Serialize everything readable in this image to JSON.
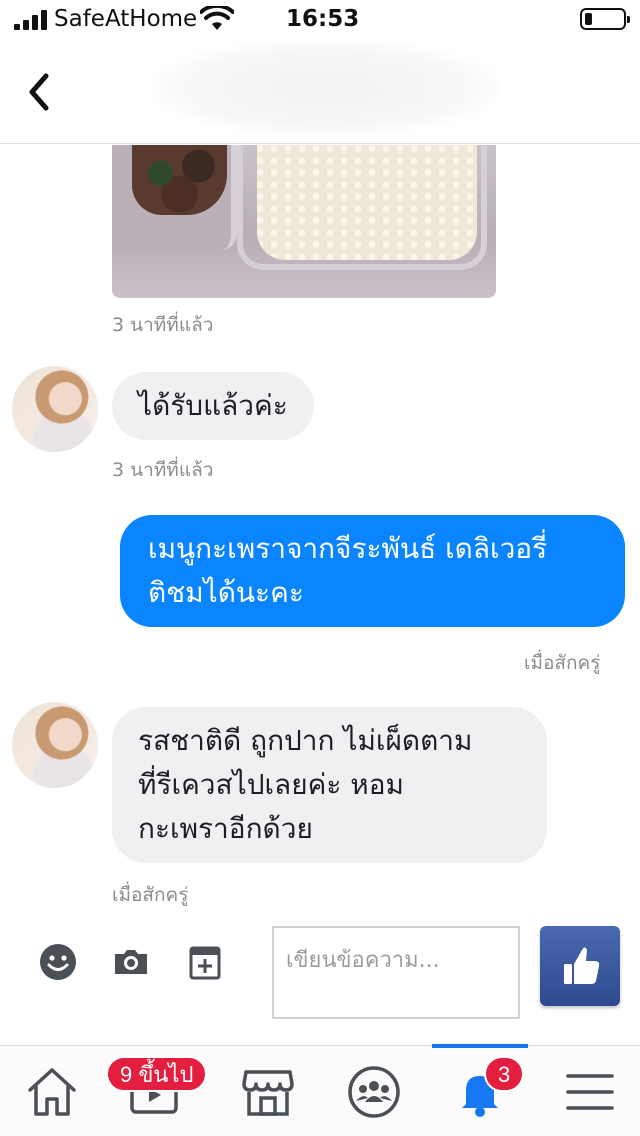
{
  "status_bar": {
    "carrier": "SafeAtHome",
    "time": "16:53"
  },
  "header": {
    "back_icon": "chevron-left-icon"
  },
  "messages": [
    {
      "type": "image",
      "direction": "incoming",
      "timestamp": "3 นาทีที่แล้ว"
    },
    {
      "type": "text",
      "direction": "incoming",
      "lines": [
        "ได้รับแล้วค่ะ"
      ],
      "timestamp": "3 นาทีที่แล้ว"
    },
    {
      "type": "text",
      "direction": "outgoing",
      "lines": [
        "เมนูกะเพราจากจีระพันธ์ เดลิเวอรี่",
        "ติชมได้นะคะ"
      ],
      "timestamp": "เมื่อสักครู่"
    },
    {
      "type": "text",
      "direction": "incoming",
      "lines": [
        "รสชาติดี ถูกปาก ไม่เผ็ดตาม",
        "ที่รีเควสไปเลยค่ะ หอม",
        "กะเพราอีกด้วย"
      ],
      "timestamp": "เมื่อสักครู่"
    }
  ],
  "composer": {
    "placeholder": "เขียนข้อความ...",
    "icons": [
      "emoji-icon",
      "camera-icon",
      "add-media-icon"
    ],
    "like_icon": "thumbs-up-icon"
  },
  "tabbar": {
    "tabs": [
      {
        "name": "home",
        "icon": "home-icon"
      },
      {
        "name": "watch",
        "icon": "video-icon",
        "badge": "9 ขึ้นไป"
      },
      {
        "name": "marketplace",
        "icon": "shop-icon"
      },
      {
        "name": "groups",
        "icon": "groups-icon"
      },
      {
        "name": "notifications",
        "icon": "bell-icon",
        "badge": "3",
        "active": true
      },
      {
        "name": "menu",
        "icon": "menu-icon"
      }
    ]
  },
  "colors": {
    "outgoing_bubble": "#0a84ff",
    "incoming_bubble": "#eff0f2",
    "accent": "#1877f2",
    "badge": "#e41e3f",
    "like_button": "#3b5998"
  }
}
